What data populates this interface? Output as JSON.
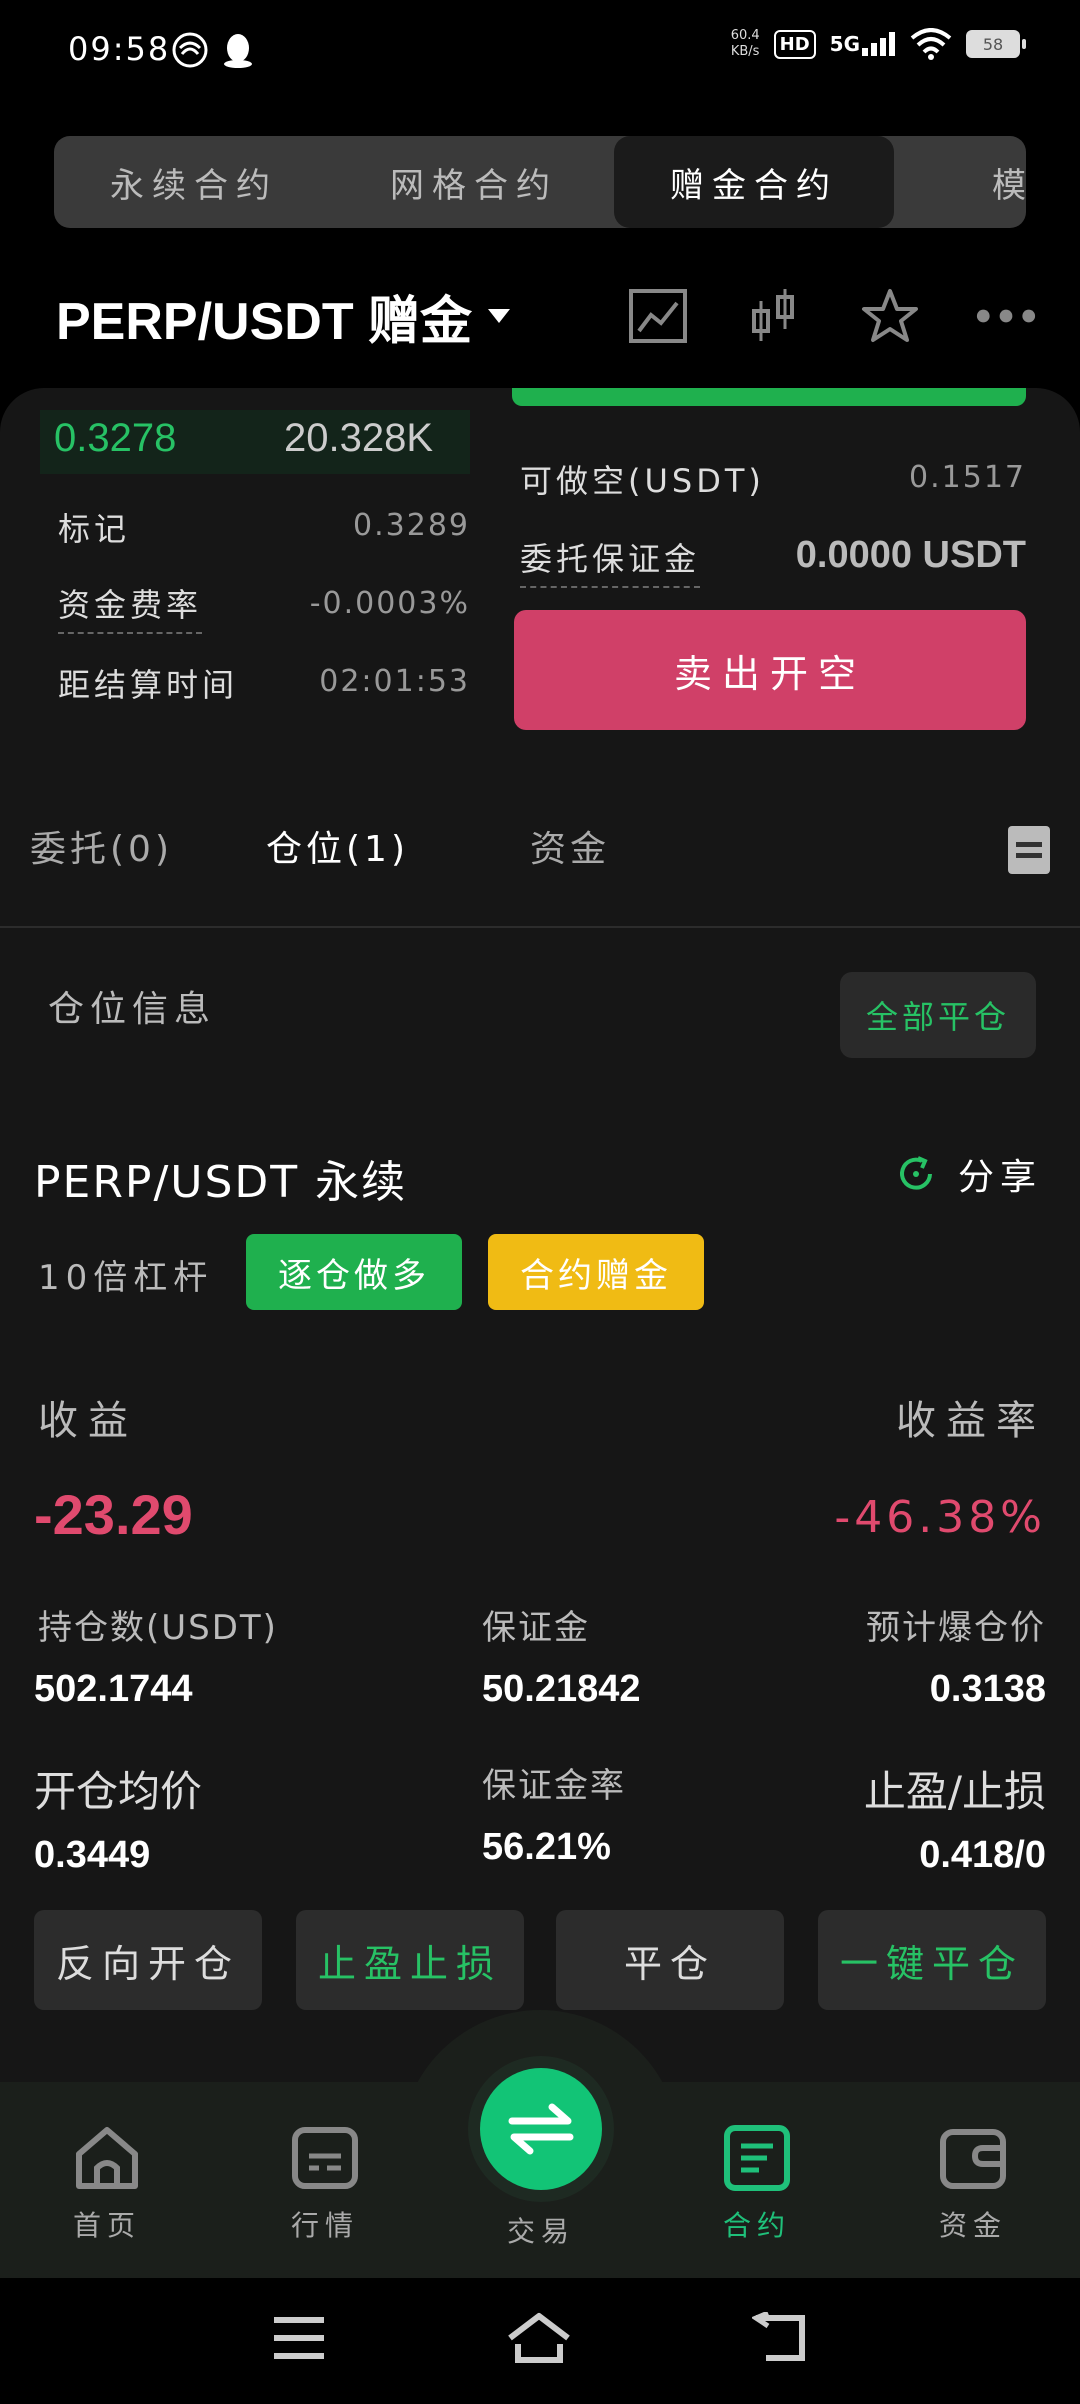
{
  "status_bar": {
    "time": "09:58",
    "net_speed_top": "60.4",
    "net_speed_bottom": "KB/s",
    "hd": "HD",
    "network": "5G",
    "battery": "58"
  },
  "contract_tabs": [
    {
      "label": "永续合约",
      "active": false
    },
    {
      "label": "网格合约",
      "active": false
    },
    {
      "label": "赠金合约",
      "active": true
    },
    {
      "label": "模拟",
      "active": false
    }
  ],
  "header": {
    "pair": "PERP/USDT  赠金"
  },
  "depth": {
    "price": "0.3278",
    "qty": "20.328K"
  },
  "market_info": {
    "mark_label": "标记",
    "mark_value": "0.3289",
    "funding_label": "资金费率",
    "funding_value": "-0.0003%",
    "settle_label": "距结算时间",
    "settle_value": "02:01:53"
  },
  "order_form": {
    "short_available_label": "可做空(USDT)",
    "short_available_value": "0.1517",
    "margin_label": "委托保证金",
    "margin_value": "0.0000 USDT",
    "sell_button": "卖出开空"
  },
  "order_tabs": {
    "orders": "委托(0)",
    "positions": "仓位(1)",
    "funds": "资金"
  },
  "positions": {
    "section_label": "仓位信息",
    "close_all": "全部平仓",
    "title": "PERP/USDT 永续",
    "share": "分享",
    "leverage": "10倍杠杆",
    "tag_side": "逐仓做多",
    "tag_bonus": "合约赠金",
    "pnl_label": "收益",
    "pnl_rate_label": "收益率",
    "pnl_value": "-23.29",
    "pnl_rate_value": "-46.38%",
    "size_label": "持仓数(USDT)",
    "size_value": "502.1744",
    "margin_label": "保证金",
    "margin_value": "50.21842",
    "liq_label": "预计爆仓价",
    "liq_value": "0.3138",
    "entry_label": "开仓均价",
    "entry_value": "0.3449",
    "margin_rate_label": "保证金率",
    "margin_rate_value": "56.21%",
    "tpsl_label": "止盈/止损",
    "tpsl_value": "0.418/0",
    "actions": [
      "反向开仓",
      "止盈止损",
      "平仓",
      "一键平仓"
    ]
  },
  "bottom_nav": [
    {
      "label": "首页",
      "icon": "home-icon"
    },
    {
      "label": "行情",
      "icon": "market-icon"
    },
    {
      "label": "交易",
      "icon": "swap-icon"
    },
    {
      "label": "合约",
      "icon": "contract-icon",
      "active": true
    },
    {
      "label": "资金",
      "icon": "wallet-icon"
    }
  ],
  "colors": {
    "green": "#27c265",
    "red": "#e04a6e",
    "sell": "#d04068",
    "yellow": "#f0bb14"
  }
}
